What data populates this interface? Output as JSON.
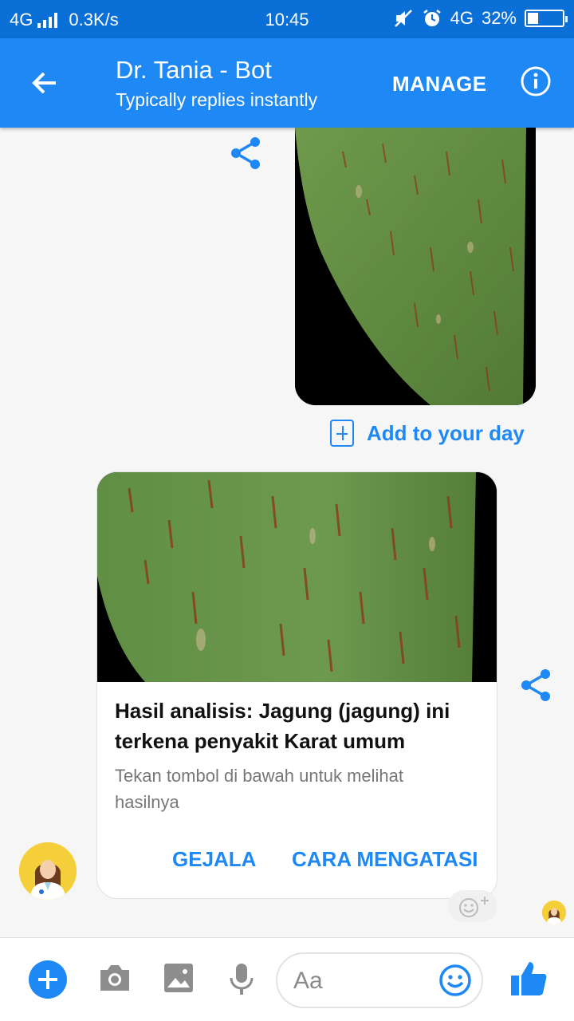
{
  "status_bar": {
    "network": "4G",
    "speed": "0.3K/s",
    "time": "10:45",
    "network_right": "4G",
    "battery_percent": "32%",
    "battery_level": 0.32
  },
  "header": {
    "title": "Dr. Tania - Bot",
    "subtitle": "Typically replies instantly",
    "manage_label": "MANAGE"
  },
  "chat": {
    "add_to_day_label": "Add to your day",
    "card": {
      "title": "Hasil analisis: Jagung (jagung) ini terkena penyakit Karat umum",
      "subtitle": "Tekan tombol di bawah untuk melihat hasilnya",
      "buttons": [
        "GEJALA",
        "CARA MENGATASI"
      ]
    }
  },
  "composer": {
    "placeholder": "Aa"
  },
  "colors": {
    "accent": "#1e88f5",
    "status_bar": "#0a6fd6",
    "avatar_bg": "#f5cf3a"
  },
  "icons": [
    "back-arrow-icon",
    "info-icon",
    "share-icon",
    "plus-icon",
    "camera-icon",
    "image-icon",
    "mic-icon",
    "emoji-icon",
    "thumbs-up-icon"
  ]
}
